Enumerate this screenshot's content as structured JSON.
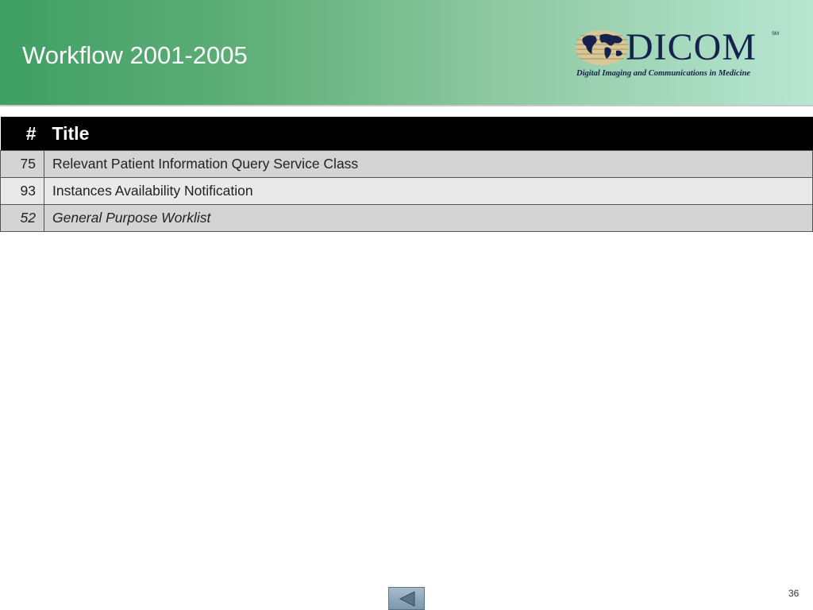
{
  "header": {
    "title": "Workflow 2001-2005"
  },
  "logo": {
    "word": "DICOM",
    "sm": "SM",
    "tagline": "Digital Imaging and Communications in Medicine"
  },
  "table": {
    "columns": [
      "#",
      "Title"
    ],
    "rows": [
      {
        "num": "75",
        "title": "Relevant Patient Information Query Service Class"
      },
      {
        "num": "93",
        "title": "Instances Availability Notification"
      },
      {
        "num": "52",
        "title": "General Purpose Worklist"
      }
    ]
  },
  "footer": {
    "page_number": "36",
    "nav_icon": "triangle-left-icon"
  },
  "colors": {
    "header_start": "#3f9f63",
    "header_end": "#b8e6d2",
    "table_header_bg": "#000000",
    "logo_navy": "#16224d"
  }
}
